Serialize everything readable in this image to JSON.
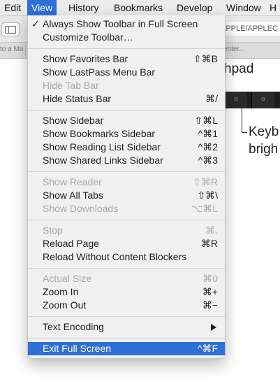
{
  "menubar": {
    "items": [
      "Edit",
      "View",
      "History",
      "Bookmarks",
      "Develop",
      "Window",
      "H"
    ]
  },
  "background": {
    "url_text": "APPLE/APPLEC",
    "tab_left": "to a Ma",
    "tab_right": "enter...",
    "heading_fragment": "hpad",
    "callout_line1": "Keyb",
    "callout_line2": "brigh",
    "key_glyph": "☼"
  },
  "menu": {
    "groups": [
      [
        {
          "label": "Always Show Toolbar in Full Screen",
          "shortcut": "",
          "checked": true,
          "disabled": false
        },
        {
          "label": "Customize Toolbar…",
          "shortcut": "",
          "disabled": false
        }
      ],
      [
        {
          "label": "Show Favorites Bar",
          "shortcut": "⇧⌘B",
          "disabled": false
        },
        {
          "label": "Show LastPass Menu Bar",
          "shortcut": "",
          "disabled": false
        },
        {
          "label": "Hide Tab Bar",
          "shortcut": "",
          "disabled": true
        },
        {
          "label": "Hide Status Bar",
          "shortcut": "⌘/",
          "disabled": false
        }
      ],
      [
        {
          "label": "Show Sidebar",
          "shortcut": "⇧⌘L",
          "disabled": false
        },
        {
          "label": "Show Bookmarks Sidebar",
          "shortcut": "^⌘1",
          "disabled": false
        },
        {
          "label": "Show Reading List Sidebar",
          "shortcut": "^⌘2",
          "disabled": false
        },
        {
          "label": "Show Shared Links Sidebar",
          "shortcut": "^⌘3",
          "disabled": false
        }
      ],
      [
        {
          "label": "Show Reader",
          "shortcut": "⇧⌘R",
          "disabled": true
        },
        {
          "label": "Show All Tabs",
          "shortcut": "⇧⌘\\",
          "disabled": false
        },
        {
          "label": "Show Downloads",
          "shortcut": "⌥⌘L",
          "disabled": true
        }
      ],
      [
        {
          "label": "Stop",
          "shortcut": "⌘.",
          "disabled": true
        },
        {
          "label": "Reload Page",
          "shortcut": "⌘R",
          "disabled": false
        },
        {
          "label": "Reload Without Content Blockers",
          "shortcut": "",
          "disabled": false
        }
      ],
      [
        {
          "label": "Actual Size",
          "shortcut": "⌘0",
          "disabled": true
        },
        {
          "label": "Zoom In",
          "shortcut": "⌘+",
          "disabled": false
        },
        {
          "label": "Zoom Out",
          "shortcut": "⌘−",
          "disabled": false
        }
      ],
      [
        {
          "label": "Text Encoding",
          "shortcut": "",
          "submenu": true,
          "disabled": false
        }
      ],
      [
        {
          "label": "Exit Full Screen",
          "shortcut": "^⌘F",
          "highlighted": true,
          "disabled": false
        }
      ]
    ]
  },
  "colors": {
    "highlight": "#2f6fd8",
    "disabled_text": "#a8a8a8"
  }
}
